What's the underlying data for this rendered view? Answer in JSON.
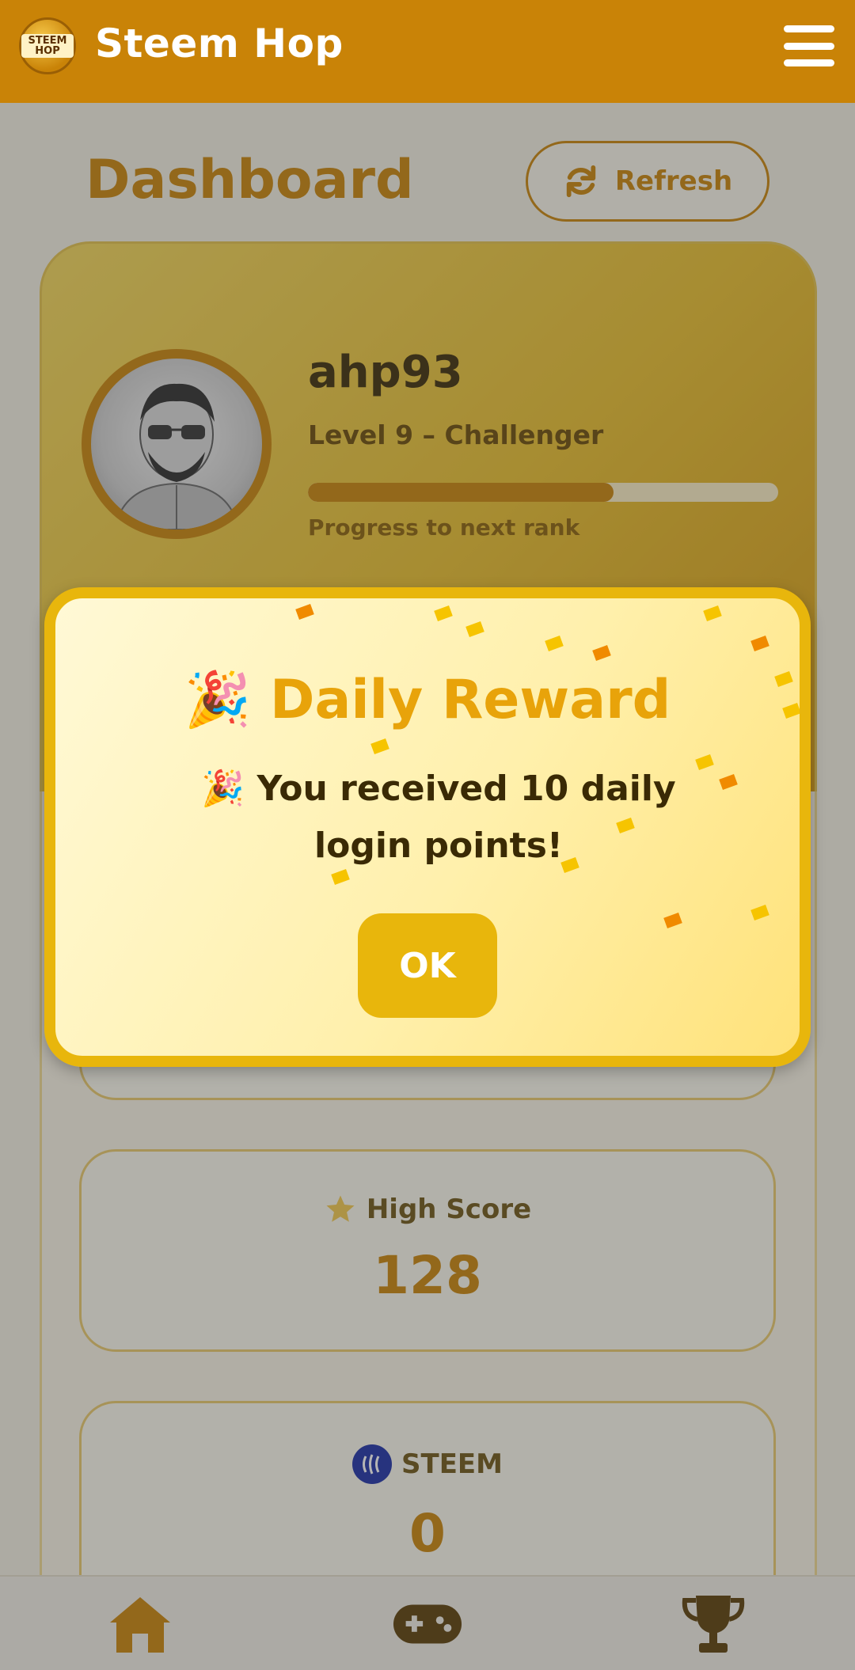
{
  "header": {
    "title": "Steem Hop",
    "logo_text": "STEEM HOP"
  },
  "dashboard": {
    "title": "Dashboard",
    "refresh_label": "Refresh"
  },
  "profile": {
    "username": "ahp93",
    "level": "Level 9 – Challenger",
    "progress_label": "Progress to next rank",
    "progress_fraction": 0.65
  },
  "stats": {
    "high_score_label": "High Score",
    "high_score_value": "128",
    "steem_label": "STEEM",
    "steem_value": "0"
  },
  "modal": {
    "title_emoji": "🎉",
    "title": "Daily Reward",
    "message": "🎉 You received 10 daily login points!",
    "ok_label": "OK"
  },
  "nav": {
    "items": [
      "home-icon",
      "gamepad-icon",
      "trophy-icon"
    ]
  },
  "colors": {
    "accent": "#c98307",
    "modal_border": "#e8b60c",
    "modal_title": "#e8a30a"
  }
}
